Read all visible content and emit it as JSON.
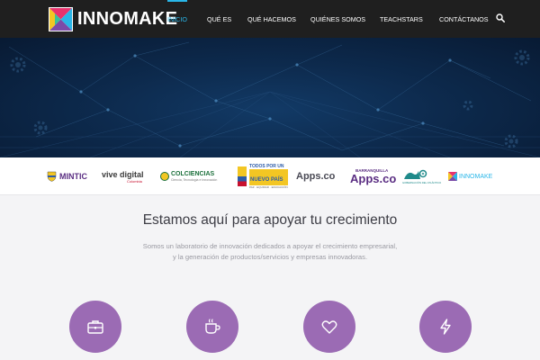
{
  "brand": {
    "name": "INNOMAKE",
    "colors": {
      "accent": "#29b6e8",
      "purple": "#9b6bb4",
      "header_bg": "#1f1f1f"
    }
  },
  "nav": {
    "items": [
      {
        "label": "INICIO",
        "active": true
      },
      {
        "label": "QUÉ ES"
      },
      {
        "label": "QUÉ HACEMOS"
      },
      {
        "label": "QUIÉNES SOMOS"
      },
      {
        "label": "TEACHSTARS"
      },
      {
        "label": "CONTÁCTANOS"
      }
    ],
    "search_icon": "search-icon"
  },
  "partners": {
    "mintic": "MINTIC",
    "vive_main": "vive digital",
    "vive_sub": "Colombia",
    "colciencias": "COLCIENCIAS",
    "colciencias_sub": "Ciencia, Tecnología e Innovación",
    "todos_1": "TODOS POR UN",
    "todos_2": "NUEVO PAÍS",
    "todos_3": "PAZ · EQUIDAD · EDUCACIÓN",
    "appsco": "Apps.co",
    "barranquilla_small": "BARRANQUILLA",
    "barranquilla_main": "Apps.co",
    "gobernacion": "GOBERNACIÓN DEL ATLÁNTICO",
    "innomake": "INNOMAKE"
  },
  "main": {
    "headline": "Estamos aquí para apoyar tu crecimiento",
    "sub_line1": "Somos un laboratorio de innovación dedicados a apoyar el crecimiento empresarial,",
    "sub_line2": "y la generación de productos/servicios y empresas innovadoras.",
    "features": [
      "briefcase-icon",
      "coffee-cup-icon",
      "heart-icon",
      "lightning-icon"
    ]
  }
}
